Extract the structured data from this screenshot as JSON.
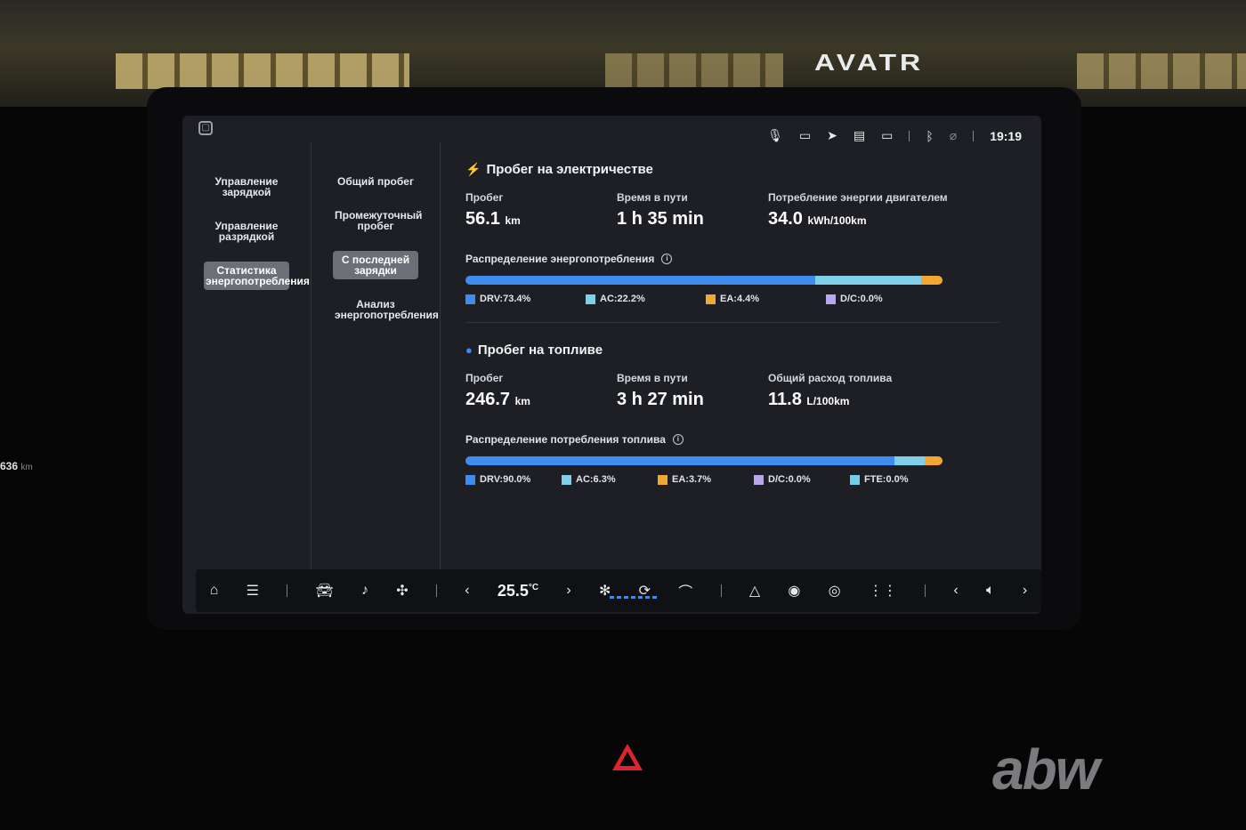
{
  "background": {
    "sign": "AVATR"
  },
  "status_bar": {
    "icons": [
      "mic-icon",
      "camera-icon",
      "location-icon",
      "message-icon",
      "battery-icon",
      "bluetooth-icon",
      "signal-off-icon"
    ],
    "time": "19:19"
  },
  "nav_primary": [
    {
      "label": "Управление зарядкой",
      "active": false
    },
    {
      "label": "Управление разрядкой",
      "active": false
    },
    {
      "label": "Статистика энергопотребления",
      "active": true
    }
  ],
  "nav_secondary": [
    {
      "label": "Общий пробег",
      "active": false
    },
    {
      "label": "Промежуточный пробег",
      "active": false
    },
    {
      "label": "С последней зарядки",
      "active": true
    },
    {
      "label": "Анализ энергопотребления",
      "active": false
    }
  ],
  "electric": {
    "title": "Пробег на электричестве",
    "stats": [
      {
        "label": "Пробег",
        "value": "56.1",
        "unit": "km"
      },
      {
        "label": "Время в пути",
        "value": "1 h 35 min",
        "unit": ""
      },
      {
        "label": "Потребление энергии двигателем",
        "value": "34.0",
        "unit": "kWh/100km"
      }
    ],
    "distribution_label": "Распределение энергопотребления",
    "segments": [
      {
        "name": "DRV",
        "label": "DRV:73.4%",
        "pct": 73.4,
        "color": "#3d8cf0"
      },
      {
        "name": "AC",
        "label": "AC:22.2%",
        "pct": 22.2,
        "color": "#7fcfe8"
      },
      {
        "name": "EA",
        "label": "EA:4.4%",
        "pct": 4.4,
        "color": "#f3a632"
      },
      {
        "name": "D/C",
        "label": "D/C:0.0%",
        "pct": 0.0,
        "color": "#b9a6ee"
      }
    ]
  },
  "fuel": {
    "title": "Пробег на топливе",
    "stats": [
      {
        "label": "Пробег",
        "value": "246.7",
        "unit": "km"
      },
      {
        "label": "Время в пути",
        "value": "3 h 27 min",
        "unit": ""
      },
      {
        "label": "Общий расход топлива",
        "value": "11.8",
        "unit": "L/100km"
      }
    ],
    "distribution_label": "Распределение потребления топлива",
    "segments": [
      {
        "name": "DRV",
        "label": "DRV:90.0%",
        "pct": 90.0,
        "color": "#3d8cf0"
      },
      {
        "name": "AC",
        "label": "AC:6.3%",
        "pct": 6.3,
        "color": "#7fcfe8"
      },
      {
        "name": "EA",
        "label": "EA:3.7%",
        "pct": 3.7,
        "color": "#f3a632"
      },
      {
        "name": "D/C",
        "label": "D/C:0.0%",
        "pct": 0.0,
        "color": "#b9a6ee"
      },
      {
        "name": "FTE",
        "label": "FTE:0.0%",
        "pct": 0.0,
        "color": "#6fd0e8"
      }
    ]
  },
  "dock": {
    "temperature": "25.5",
    "temperature_unit": "°C"
  },
  "side_readout": {
    "value": "636",
    "unit": "km"
  },
  "watermark": "abw"
}
